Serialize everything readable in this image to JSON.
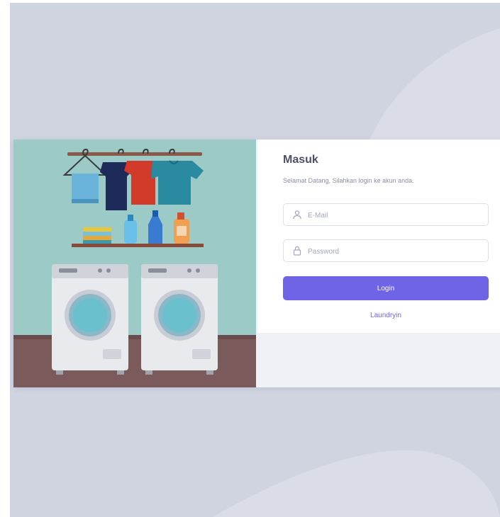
{
  "login": {
    "title": "Masuk",
    "subtitle": "Selamat Datang, Silahkan login ke akun anda.",
    "email_placeholder": "E-Mail",
    "password_placeholder": "Password",
    "login_label": "Login",
    "brand_link": "Laundryin"
  },
  "icons": {
    "email": "user-icon",
    "password": "lock-icon"
  },
  "colors": {
    "page_background": "#d0d4e0",
    "accent": "#7064e6",
    "illustration_wall": "#9ccac6",
    "illustration_floor": "#7a5a5a"
  }
}
